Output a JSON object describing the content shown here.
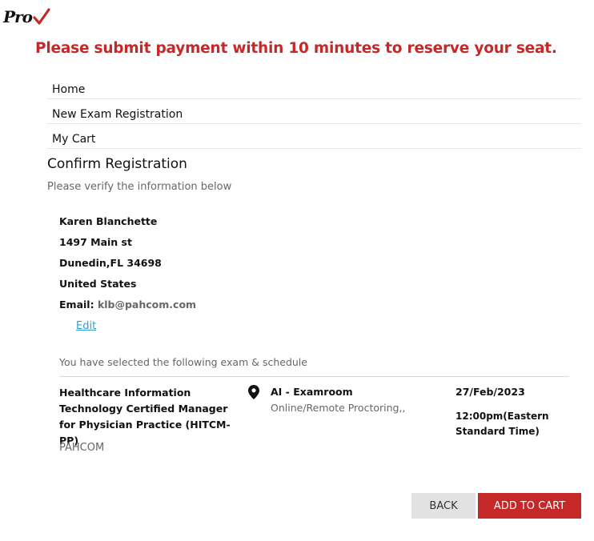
{
  "header": {
    "logo_text": "Pro",
    "notice": "Please submit payment within 10 minutes to reserve your seat."
  },
  "nav": {
    "items": [
      {
        "label": "Home"
      },
      {
        "label": "New Exam Registration"
      },
      {
        "label": "My Cart"
      }
    ]
  },
  "confirm": {
    "title": "Confirm Registration",
    "subtitle": "Please verify the information below"
  },
  "candidate": {
    "name": "Karen Blanchette",
    "address1": "1497 Main st",
    "city_state_zip": "Dunedin,FL 34698",
    "country": "United States",
    "email_label": "Email:",
    "email": "klb@pahcom.com",
    "edit_label": "Edit"
  },
  "schedule": {
    "intro": "You have selected the following exam & schedule",
    "exam_name": "Healthcare Information Technology Certified Manager for Physician Practice (HITCM-PP)",
    "provider": "PAHCOM",
    "location": "AI - Examroom",
    "location_detail": "Online/Remote Proctoring,,",
    "date": "27/Feb/2023",
    "time": "12:00pm(Eastern Standard Time)"
  },
  "buttons": {
    "back": "BACK",
    "add_to_cart": "ADD TO CART"
  },
  "colors": {
    "accent_red": "#c62828",
    "link_blue": "#2a9fd6"
  }
}
